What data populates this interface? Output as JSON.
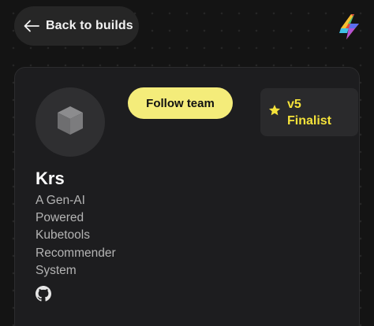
{
  "nav": {
    "back_label": "Back to builds"
  },
  "project": {
    "team_name": "Krs",
    "description_lines": [
      "A Gen-AI",
      "Powered",
      "Kubetools",
      "Recommender",
      "System"
    ],
    "follow_label": "Follow team",
    "badge": {
      "line1": "v5",
      "line2": "Finalist",
      "icon": "star-icon"
    },
    "avatar_icon": "cube-icon",
    "links": [
      {
        "icon": "github-icon"
      }
    ]
  },
  "colors": {
    "accent": "#f4ec7a",
    "badge_text": "#f4e23a",
    "card_bg": "#1d1d1f",
    "page_bg": "#141414"
  }
}
